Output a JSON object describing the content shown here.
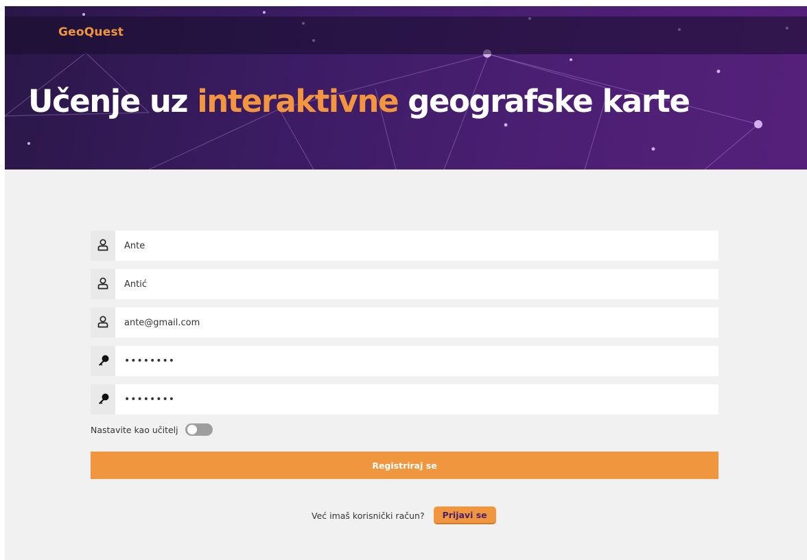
{
  "header": {
    "brand": "GeoQuest",
    "headline_part1": "Učenje uz ",
    "headline_accent": "interaktivne",
    "headline_part2": " geografske karte"
  },
  "form": {
    "first_name": {
      "value": "Ante",
      "icon": "user-icon"
    },
    "last_name": {
      "value": "Antić",
      "icon": "user-icon"
    },
    "email": {
      "value": "ante@gmail.com",
      "icon": "user-icon"
    },
    "password": {
      "value": "12345678",
      "icon": "key-icon"
    },
    "confirm_password": {
      "value": "12345678",
      "icon": "key-icon"
    },
    "teacher_toggle_label": "Nastavite kao učitelj",
    "teacher_toggle_on": false,
    "register_label": "Registriraj se"
  },
  "footer": {
    "question": "Već imaš korisnički račun?",
    "login_label": "Prijavi se"
  },
  "colors": {
    "accent": "#f0963f",
    "hero_dark": "#2a1747",
    "hero_purple": "#55207a",
    "login_text": "#4a1e6e"
  }
}
